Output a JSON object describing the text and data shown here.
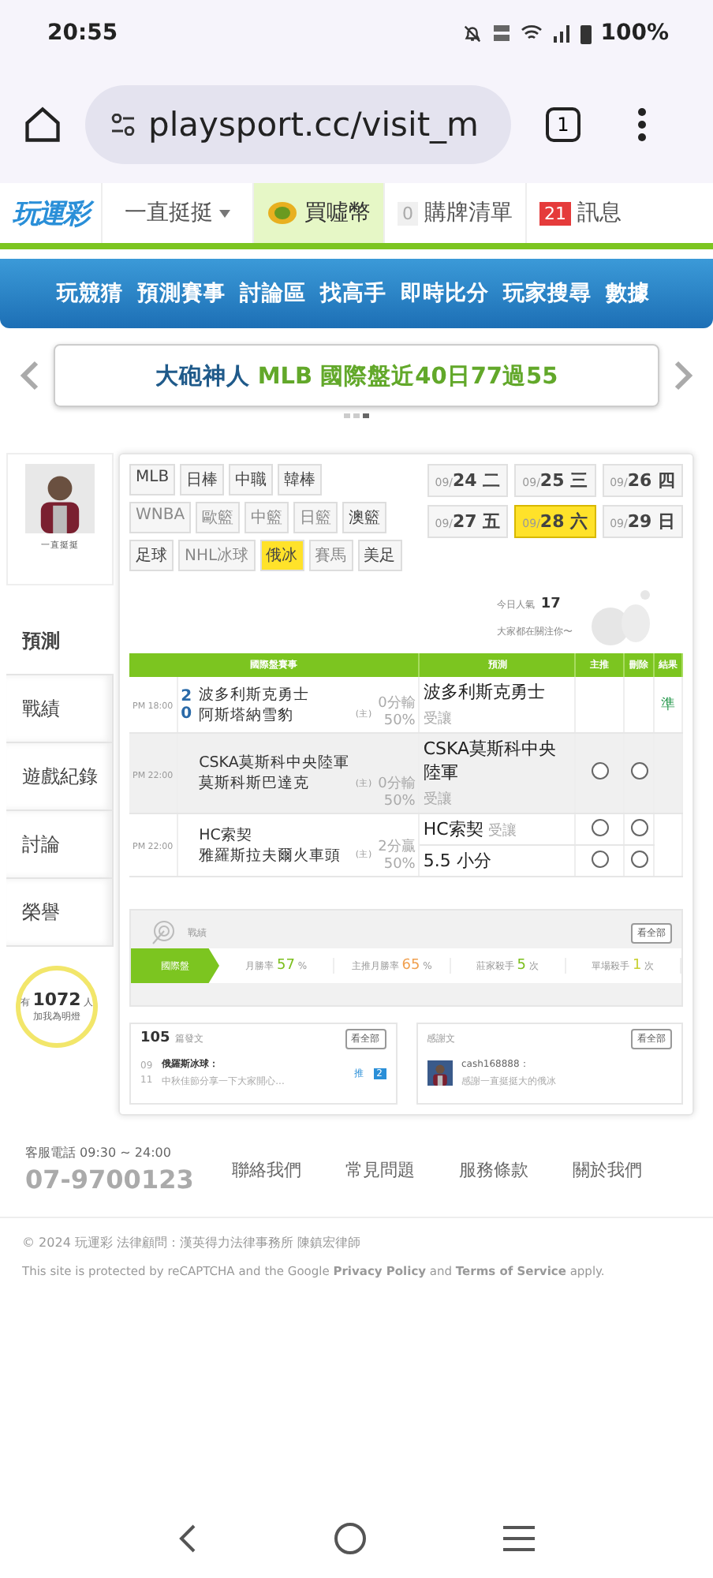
{
  "status_bar": {
    "time": "20:55",
    "battery": "100%"
  },
  "browser": {
    "url": "playsport.cc/visit_m",
    "tab_count": "1"
  },
  "site_header": {
    "logo": "玩運彩",
    "user": "一直挺挺",
    "coins": "買噓幣",
    "cart_count": "0",
    "cart": "購牌清單",
    "msg_count": "21",
    "messages": "訊息"
  },
  "nav": [
    "玩競猜",
    "預測賽事",
    "討論區",
    "找高手",
    "即時比分",
    "玩家搜尋",
    "數據"
  ],
  "banner": {
    "name": "大砲神人",
    "text": "MLB 國際盤近40日77過55"
  },
  "profile": {
    "name": "一直挺挺"
  },
  "side_menu": [
    {
      "label": "預測",
      "selected": true
    },
    {
      "label": "戰績",
      "selected": false
    },
    {
      "label": "遊戲紀錄",
      "selected": false
    },
    {
      "label": "討論",
      "selected": false
    },
    {
      "label": "榮譽",
      "selected": false
    }
  ],
  "fans": {
    "prefix": "有",
    "count": "1072",
    "suffix": "人",
    "text": "加我為明燈"
  },
  "sports": [
    [
      {
        "label": "MLB",
        "disabled": false,
        "selected": false
      },
      {
        "label": "日棒",
        "disabled": false,
        "selected": false
      },
      {
        "label": "中職",
        "disabled": false,
        "selected": false
      },
      {
        "label": "韓棒",
        "disabled": false,
        "selected": false
      }
    ],
    [
      {
        "label": "WNBA",
        "disabled": true,
        "selected": false
      },
      {
        "label": "歐籃",
        "disabled": true,
        "selected": false
      },
      {
        "label": "中籃",
        "disabled": true,
        "selected": false
      },
      {
        "label": "日籃",
        "disabled": true,
        "selected": false
      },
      {
        "label": "澳籃",
        "disabled": false,
        "selected": false
      }
    ],
    [
      {
        "label": "足球",
        "disabled": false,
        "selected": false
      },
      {
        "label": "NHL冰球",
        "disabled": true,
        "selected": false
      },
      {
        "label": "俄冰",
        "disabled": false,
        "selected": true
      },
      {
        "label": "賽馬",
        "disabled": true,
        "selected": false
      },
      {
        "label": "美足",
        "disabled": false,
        "selected": false
      }
    ]
  ],
  "dates": [
    {
      "date": "09/",
      "day": "24",
      "weekday": "二",
      "selected": false
    },
    {
      "date": "09/",
      "day": "25",
      "weekday": "三",
      "selected": false
    },
    {
      "date": "09/",
      "day": "26",
      "weekday": "四",
      "selected": false
    },
    {
      "date": "09/",
      "day": "27",
      "weekday": "五",
      "selected": false
    },
    {
      "date": "09/",
      "day": "28",
      "weekday": "六",
      "selected": true
    },
    {
      "date": "09/",
      "day": "29",
      "weekday": "日",
      "selected": false
    }
  ],
  "popularity": {
    "label": "今日人氣",
    "count": "17",
    "note": "大家都在關注你〜"
  },
  "table": {
    "columns": [
      "國際盤賽事",
      "預測",
      "主推",
      "刪除",
      "結果"
    ],
    "rows": [
      {
        "time": "PM 18:00",
        "scores": [
          "2",
          "0"
        ],
        "teams": [
          "波多利斯克勇士",
          "阿斯塔納雪豹"
        ],
        "home_tag": "(主)",
        "line": "0分輸",
        "pct": "50%",
        "shaded": false,
        "kind": "settled",
        "picks": [
          {
            "team": "波多利斯克勇士",
            "note": "受讓"
          }
        ],
        "result": "準"
      },
      {
        "time": "PM 22:00",
        "teams": [
          "CSKA莫斯科中央陸軍",
          "莫斯科斯巴達克"
        ],
        "home_tag": "(主)",
        "line": "0分輸",
        "pct": "50%",
        "shaded": true,
        "kind": "open",
        "picks": [
          {
            "team": "CSKA莫斯科中央陸軍",
            "note": "受讓",
            "main": false,
            "delete": false
          }
        ]
      },
      {
        "time": "PM 22:00",
        "teams": [
          "HC索契",
          "雅羅斯拉夫爾火車頭"
        ],
        "home_tag": "(主)",
        "line": "2分贏",
        "pct": "50%",
        "shaded": false,
        "kind": "open",
        "picks": [
          {
            "team": "HC索契",
            "note": "受讓",
            "main": false,
            "delete": false
          },
          {
            "team": "5.5 小分",
            "main": false,
            "delete": false
          }
        ]
      }
    ]
  },
  "record": {
    "title": "戰績",
    "more": "看全部",
    "stats": [
      {
        "kind": "tab",
        "label": "國際盤"
      },
      {
        "kind": "stat",
        "label": "月勝率",
        "value": "57",
        "unit": "%",
        "color": "#7cbf1e"
      },
      {
        "kind": "stat",
        "label": "主推月勝率",
        "value": "65",
        "unit": "%",
        "color": "#f0a050"
      },
      {
        "kind": "stat",
        "label": "莊家殺手",
        "value": "5",
        "unit": "次",
        "color": "#7cbf1e"
      },
      {
        "kind": "stat",
        "label": "單場殺手",
        "value": "1",
        "unit": "次",
        "color": "#c8d030"
      }
    ]
  },
  "posts": {
    "count": "105",
    "label": "篇發文",
    "more": "看全部",
    "item": {
      "month": "09",
      "day": "11",
      "title": "俄羅斯冰球：",
      "excerpt": "中秋佳節分享一下大家開心...",
      "badge_label": "推",
      "badge": "2"
    }
  },
  "thanks": {
    "label": "感謝文",
    "more": "看全部",
    "item": {
      "user": "cash168888：",
      "text": "感謝一直挺挺大的俄冰"
    }
  },
  "footer": {
    "hotline_label": "客服電話 09:30 ~ 24:00",
    "phone": "07-9700123",
    "links": [
      "聯絡我們",
      "常見問題",
      "服務條款",
      "關於我們"
    ],
    "copyright": "© 2024 玩運彩 法律顧問：漢英得力法律事務所 陳鎮宏律師",
    "recaptcha": "This site is protected by reCAPTCHA and the Google **Privacy Policy** and **Terms of Service** apply."
  }
}
